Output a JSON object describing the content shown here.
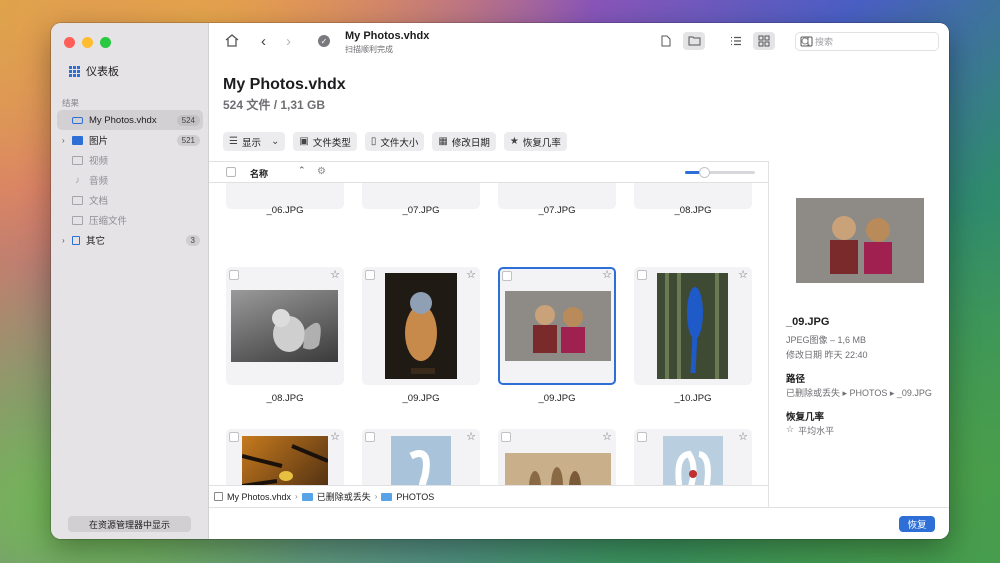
{
  "sidebar": {
    "dashboard_label": "仪表板",
    "section_label": "结果",
    "items": [
      {
        "label": "My Photos.vhdx",
        "count": "524"
      },
      {
        "label": "图片",
        "count": "521"
      },
      {
        "label": "视频",
        "count": ""
      },
      {
        "label": "音频",
        "count": ""
      },
      {
        "label": "文档",
        "count": ""
      },
      {
        "label": "压缩文件",
        "count": ""
      },
      {
        "label": "其它",
        "count": "3"
      }
    ],
    "show_in_explorer": "在资源管理器中显示"
  },
  "toolbar": {
    "title": "My Photos.vhdx",
    "subtitle": "扫描顺利完成",
    "search_placeholder": "搜索"
  },
  "header": {
    "title": "My Photos.vhdx",
    "summary": "524 文件 / 1,31 GB"
  },
  "filters": {
    "show": "显示",
    "file_type": "文件类型",
    "file_size": "文件大小",
    "modified_date": "修改日期",
    "recovery_chance": "恢复几率"
  },
  "list_header": {
    "name": "名称"
  },
  "files": {
    "row0": [
      "_06.JPG",
      "_07.JPG",
      "_07.JPG",
      "_08.JPG"
    ],
    "row1": [
      "_08.JPG",
      "_09.JPG",
      "_09.JPG",
      "_10.JPG"
    ]
  },
  "detail": {
    "filename": "_09.JPG",
    "type_size": "JPEG图像 – 1,6 MB",
    "modified": "修改日期  昨天 22:40",
    "path_label": "路径",
    "path_value": "已删除或丢失 ▸ PHOTOS ▸ _09.JPG",
    "chance_label": "恢复几率",
    "chance_value": "平均水平"
  },
  "breadcrumb": {
    "root": "My Photos.vhdx",
    "folder1": "已删除或丢失",
    "folder2": "PHOTOS"
  },
  "recover_button": "恢复",
  "colors": {
    "accent": "#2d6fd6",
    "sidebar_bg": "#e6e3e6"
  }
}
